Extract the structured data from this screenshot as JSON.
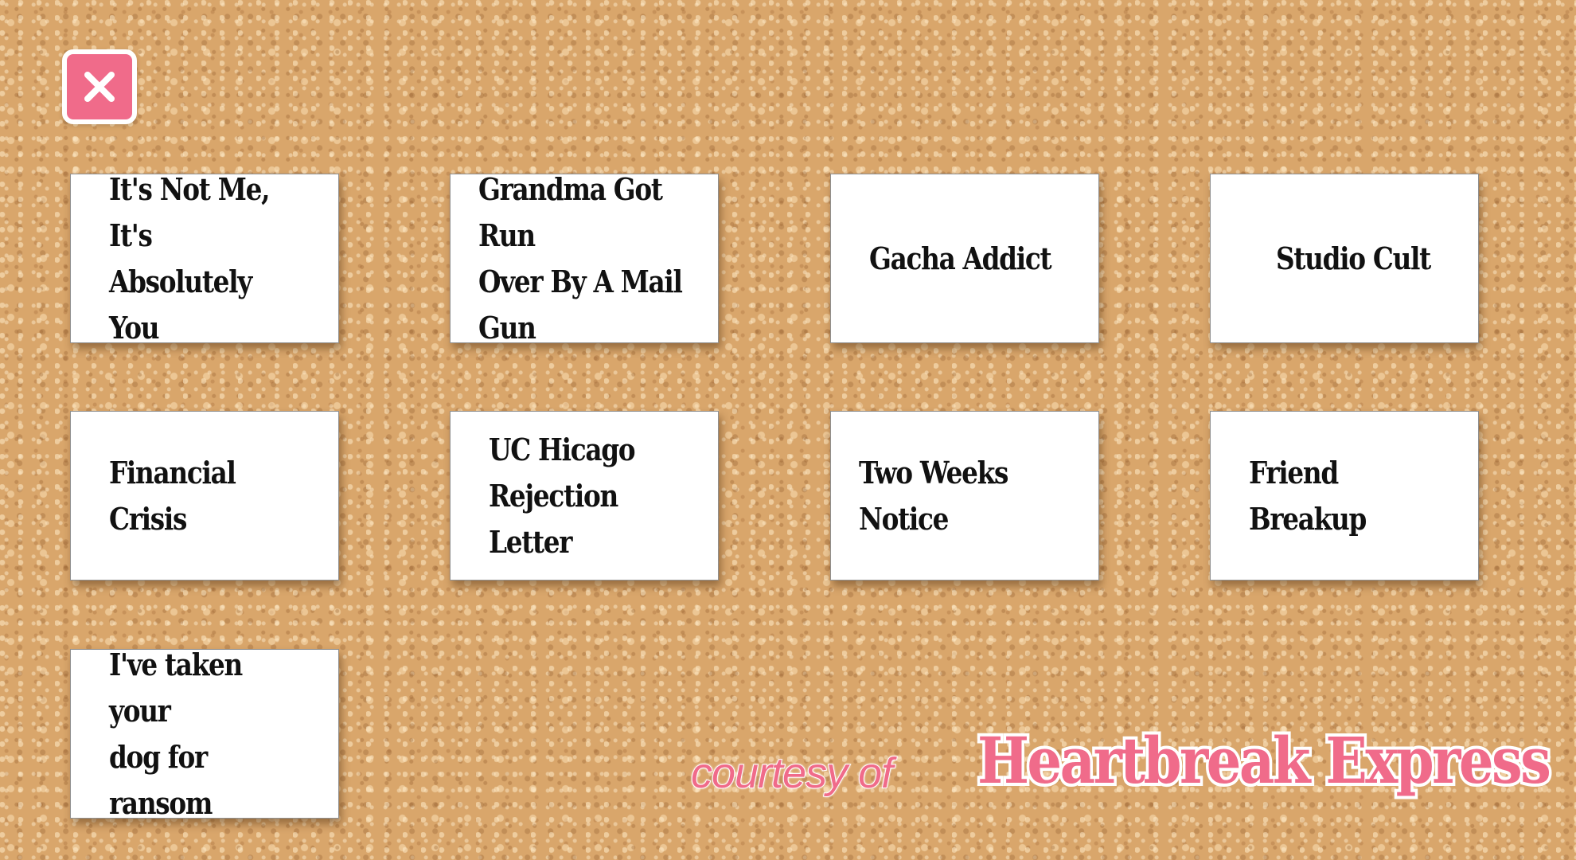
{
  "close_button": {
    "icon": "close-icon",
    "color": "#f06b8a"
  },
  "cards": [
    {
      "label": "It's Not Me, It's\nAbsolutely You"
    },
    {
      "label": "Grandma Got Run\nOver By A Mail\nGun"
    },
    {
      "label": "Gacha Addict"
    },
    {
      "label": "Studio Cult"
    },
    {
      "label": "Financial Crisis"
    },
    {
      "label": "UC Hicago\nRejection Letter"
    },
    {
      "label": "Two Weeks Notice"
    },
    {
      "label": "Friend Breakup"
    },
    {
      "label": "I've taken your\ndog for ransom"
    }
  ],
  "footer": {
    "courtesy": "courtesy of",
    "brand": "Heartbreak Express",
    "brand_color": "#f06b8a"
  }
}
